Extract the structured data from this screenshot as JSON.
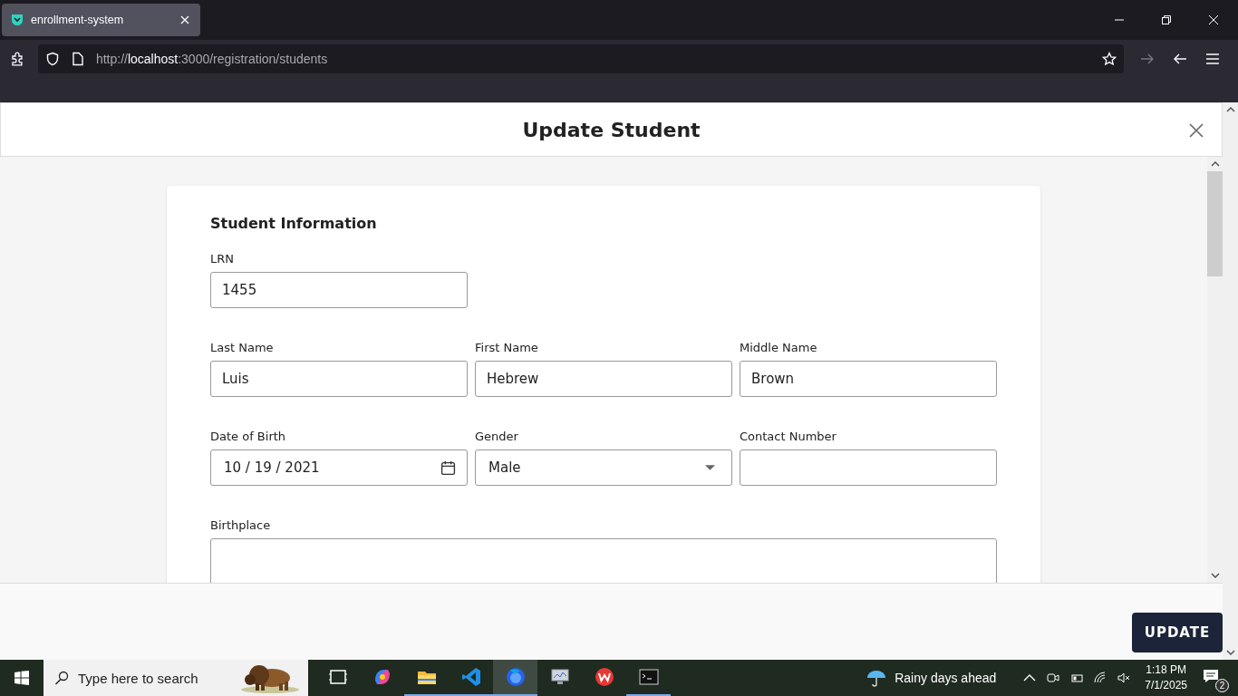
{
  "browser": {
    "tab": {
      "title": "enrollment-system",
      "selected": true
    },
    "url": {
      "scheme": "http://",
      "host": "localhost",
      "rest": ":3000/registration/students"
    }
  },
  "modal": {
    "title": "Update Student",
    "section_title": "Student Information",
    "rows": [
      [
        {
          "label": "LRN",
          "value": "1455",
          "kind": "text"
        }
      ],
      [
        {
          "label": "Last Name",
          "value": "Luis",
          "kind": "text"
        },
        {
          "label": "First Name",
          "value": "Hebrew",
          "kind": "text"
        },
        {
          "label": "Middle Name",
          "value": "Brown",
          "kind": "text"
        }
      ],
      [
        {
          "label": "Date of Birth",
          "value": "10 / 19 / 2021",
          "kind": "date"
        },
        {
          "label": "Gender",
          "value": "Male",
          "kind": "select"
        },
        {
          "label": "Contact Number",
          "kind": "text"
        }
      ],
      [
        {
          "label": "Birthplace",
          "kind": "textarea"
        }
      ]
    ],
    "button": "UPDATE"
  },
  "taskbar": {
    "search_placeholder": "Type here to search",
    "apps": [
      {
        "kind": "taskview",
        "running": false,
        "selected": false
      },
      {
        "kind": "copilot",
        "running": false,
        "selected": false
      },
      {
        "kind": "folder",
        "running": true,
        "selected": false
      },
      {
        "kind": "code",
        "running": true,
        "selected": false
      },
      {
        "kind": "browser",
        "running": true,
        "selected": true
      },
      {
        "kind": "monitor",
        "running": false,
        "selected": false
      },
      {
        "kind": "office",
        "running": false,
        "selected": false
      },
      {
        "kind": "terminal",
        "running": true,
        "selected": false
      }
    ],
    "weather": "Rainy days ahead",
    "time": "1:18 PM",
    "date": "7/1/2025",
    "notifications": "2"
  }
}
